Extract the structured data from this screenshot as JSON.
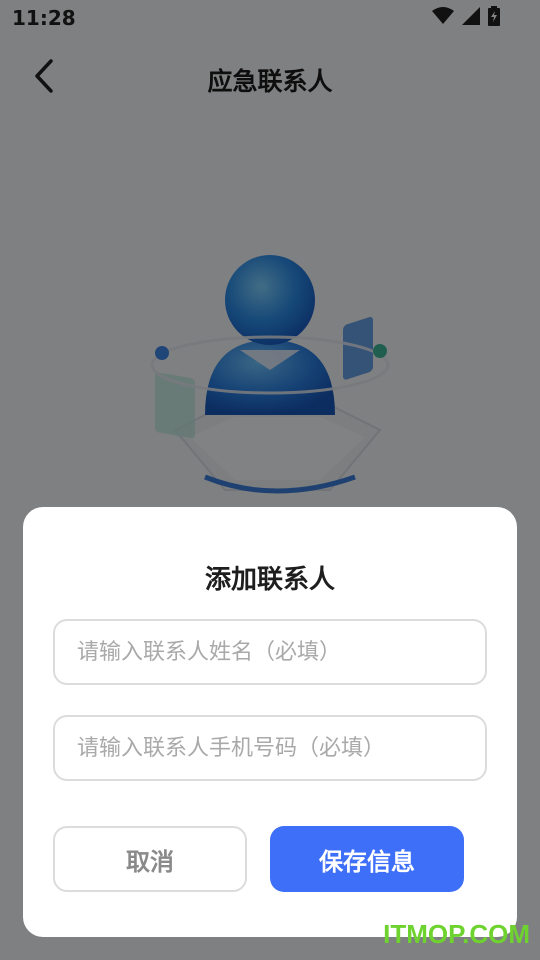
{
  "status_bar": {
    "time": "11:28"
  },
  "header": {
    "title": "应急联系人"
  },
  "dialog": {
    "title": "添加联系人",
    "name_input": {
      "placeholder": "请输入联系人姓名（必填）",
      "value": ""
    },
    "phone_input": {
      "placeholder": "请输入联系人手机号码（必填）",
      "value": ""
    },
    "cancel_label": "取消",
    "save_label": "保存信息"
  },
  "watermark": "ITMOP.COM",
  "colors": {
    "accent": "#3e6ff8",
    "watermark": "#6fd32f"
  }
}
